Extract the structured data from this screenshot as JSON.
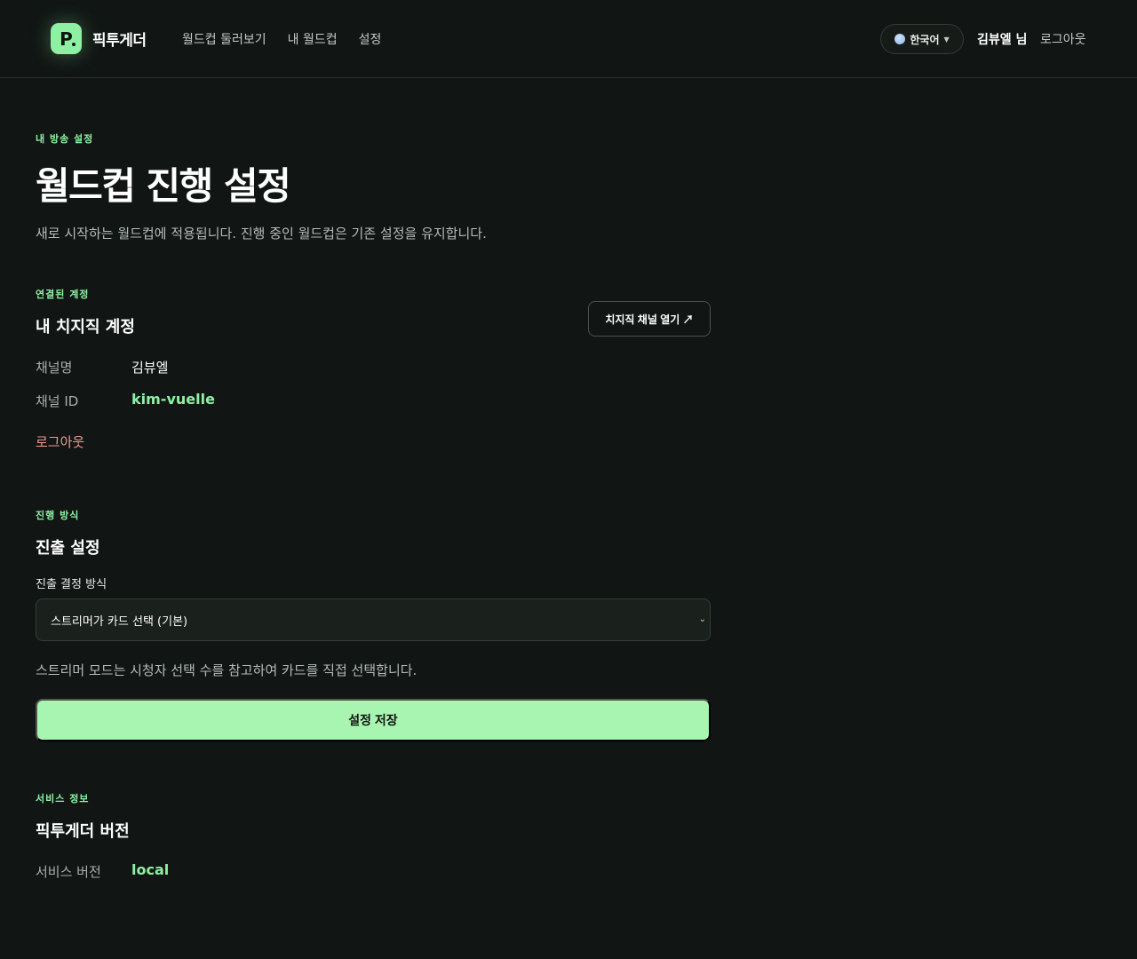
{
  "header": {
    "logo_letter": "P",
    "brand": "픽투게더",
    "nav": [
      "월드컵 둘러보기",
      "내 월드컵",
      "설정"
    ],
    "language": "한국어",
    "user": "김뷰엘 님",
    "logout": "로그아웃"
  },
  "page": {
    "eyebrow": "내 방송 설정",
    "title": "월드컵 진행 설정",
    "description": "새로 시작하는 월드컵에 적용됩니다. 진행 중인 월드컵은 기존 설정을 유지합니다."
  },
  "account": {
    "eyebrow": "연결된 계정",
    "title": "내 치지직 계정",
    "open_button": "치지직 채널 열기 ↗",
    "channel_name_label": "채널명",
    "channel_name": "김뷰엘",
    "channel_id_label": "채널 ID",
    "channel_id": "kim-vuelle",
    "logout": "로그아웃"
  },
  "progress": {
    "eyebrow": "진행 방식",
    "title": "진출 설정",
    "field_label": "진출 결정 방식",
    "selected_option": "스트리머가 카드 선택 (기본)",
    "help": "스트리머 모드는 시청자 선택 수를 참고하여 카드를 직접 선택합니다.",
    "save_button": "설정 저장"
  },
  "service": {
    "eyebrow": "서비스 정보",
    "title": "픽투게더 버전",
    "version_label": "서비스 버전",
    "version": "local"
  },
  "colors": {
    "accent": "#8ef0a2",
    "background": "#111614",
    "danger": "#ef9a95"
  }
}
